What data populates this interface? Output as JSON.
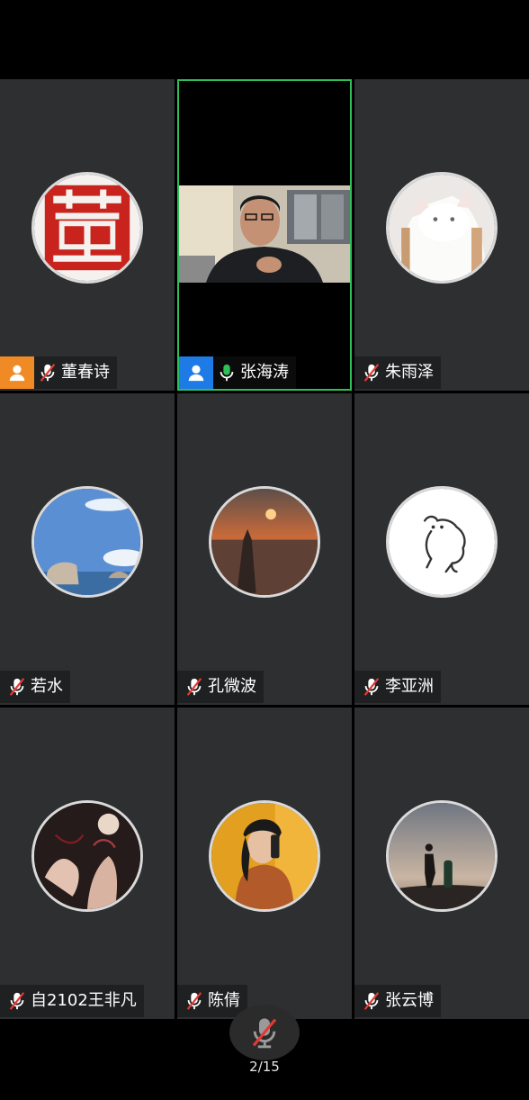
{
  "participants": [
    {
      "name": "董春诗",
      "host": true,
      "host_color": "#f08a24",
      "muted": true,
      "video": false,
      "avatar": "red-seal-avatar"
    },
    {
      "name": "张海涛",
      "host": true,
      "host_color": "#1e7be6",
      "muted": false,
      "video": true,
      "active_speaker": true,
      "avatar": "camera-feed"
    },
    {
      "name": "朱雨泽",
      "host": false,
      "muted": true,
      "video": false,
      "avatar": "white-cat-avatar"
    },
    {
      "name": "若水",
      "host": false,
      "muted": true,
      "video": false,
      "avatar": "sky-rocks-avatar"
    },
    {
      "name": "孔微波",
      "host": false,
      "muted": true,
      "video": false,
      "avatar": "sunset-sea-avatar"
    },
    {
      "name": "李亚洲",
      "host": false,
      "muted": true,
      "video": false,
      "avatar": "sketch-dog-avatar"
    },
    {
      "name": "自2102王非凡",
      "host": false,
      "muted": true,
      "video": false,
      "avatar": "hands-art-avatar"
    },
    {
      "name": "陈倩",
      "host": false,
      "muted": true,
      "video": false,
      "avatar": "woman-cap-avatar"
    },
    {
      "name": "张云博",
      "host": false,
      "muted": true,
      "video": false,
      "avatar": "silhouette-dusk-avatar"
    }
  ],
  "controls": {
    "mic_state": "muted",
    "page_indicator": "2/15"
  },
  "colors": {
    "tile_bg": "#2e2f31",
    "active_border": "#2fbf59",
    "mic_on": "#2fbf59",
    "mic_off_slash": "#e53935"
  }
}
